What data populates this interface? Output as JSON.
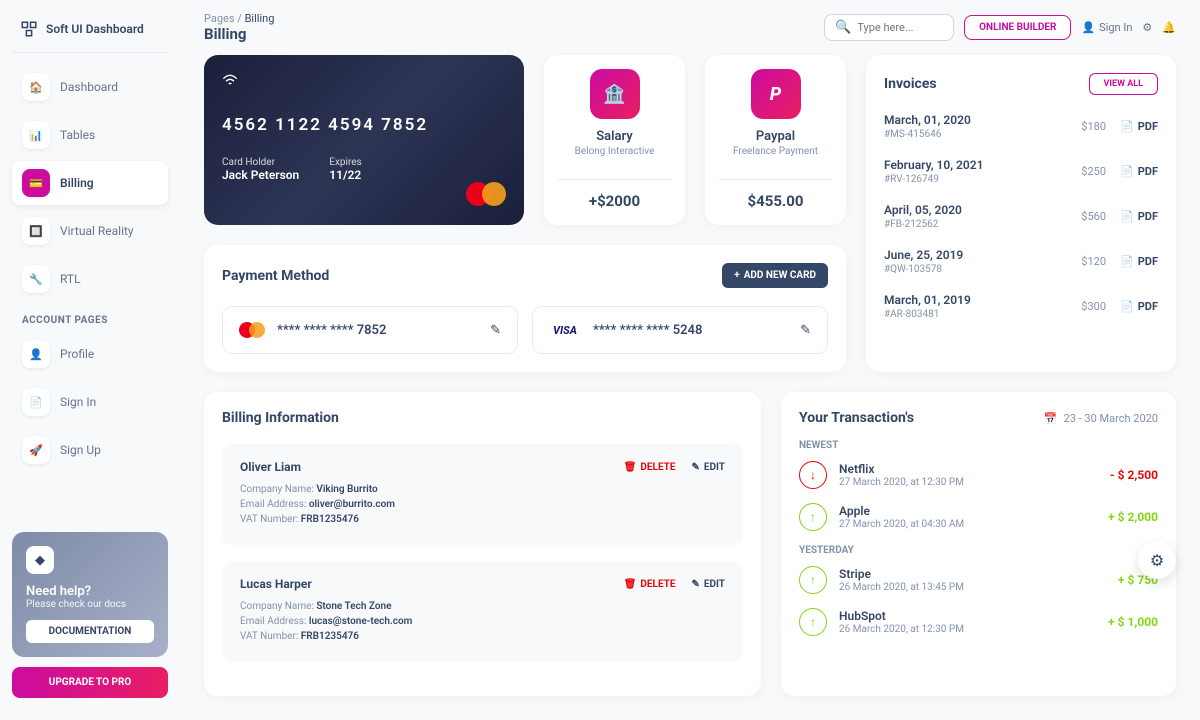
{
  "brand": "Soft UI Dashboard",
  "breadcrumb": {
    "root": "Pages",
    "current": "Billing"
  },
  "page_title": "Billing",
  "search_placeholder": "Type here...",
  "topbar": {
    "online_builder": "ONLINE BUILDER",
    "sign_in": "Sign In"
  },
  "nav": {
    "primary": [
      {
        "label": "Dashboard",
        "icon": "🏠"
      },
      {
        "label": "Tables",
        "icon": "📊"
      },
      {
        "label": "Billing",
        "icon": "💳"
      },
      {
        "label": "Virtual Reality",
        "icon": "🔲"
      },
      {
        "label": "RTL",
        "icon": "🔧"
      }
    ],
    "section": "ACCOUNT PAGES",
    "account": [
      {
        "label": "Profile",
        "icon": "👤"
      },
      {
        "label": "Sign In",
        "icon": "📄"
      },
      {
        "label": "Sign Up",
        "icon": "🚀"
      }
    ]
  },
  "help": {
    "title": "Need help?",
    "sub": "Please check our docs",
    "btn": "DOCUMENTATION"
  },
  "upgrade": "UPGRADE TO PRO",
  "credit_card": {
    "number": "4562   1122   4594   7852",
    "holder_label": "Card Holder",
    "holder": "Jack Peterson",
    "expires_label": "Expires",
    "expires": "11/22"
  },
  "stats": [
    {
      "title": "Salary",
      "sub": "Belong Interactive",
      "value": "+$2000",
      "icon": "🏦"
    },
    {
      "title": "Paypal",
      "sub": "Freelance Payment",
      "value": "$455.00",
      "icon": "P"
    }
  ],
  "invoices": {
    "title": "Invoices",
    "view_all": "VIEW ALL",
    "pdf": "PDF",
    "items": [
      {
        "date": "March, 01, 2020",
        "id": "#MS-415646",
        "amount": "$180"
      },
      {
        "date": "February, 10, 2021",
        "id": "#RV-126749",
        "amount": "$250"
      },
      {
        "date": "April, 05, 2020",
        "id": "#FB-212562",
        "amount": "$560"
      },
      {
        "date": "June, 25, 2019",
        "id": "#QW-103578",
        "amount": "$120"
      },
      {
        "date": "March, 01, 2019",
        "id": "#AR-803481",
        "amount": "$300"
      }
    ]
  },
  "payment_method": {
    "title": "Payment Method",
    "add": "ADD NEW CARD",
    "cards": [
      {
        "brand": "mastercard",
        "masked": "****   ****   ****   7852"
      },
      {
        "brand": "visa",
        "masked": "****   ****   ****   5248"
      }
    ]
  },
  "billing_info": {
    "title": "Billing Information",
    "labels": {
      "company": "Company Name:",
      "email": "Email Address:",
      "vat": "VAT Number:"
    },
    "delete": "DELETE",
    "edit": "EDIT",
    "items": [
      {
        "name": "Oliver Liam",
        "company": "Viking Burrito",
        "email": "oliver@burrito.com",
        "vat": "FRB1235476"
      },
      {
        "name": "Lucas Harper",
        "company": "Stone Tech Zone",
        "email": "lucas@stone-tech.com",
        "vat": "FRB1235476"
      }
    ]
  },
  "transactions": {
    "title": "Your Transaction's",
    "range": "23 - 30 March 2020",
    "sections": {
      "newest": "NEWEST",
      "yesterday": "YESTERDAY"
    },
    "newest": [
      {
        "name": "Netflix",
        "time": "27 March 2020, at 12:30 PM",
        "amount": "- $ 2,500",
        "dir": "down"
      },
      {
        "name": "Apple",
        "time": "27 March 2020, at 04:30 AM",
        "amount": "+ $ 2,000",
        "dir": "up"
      }
    ],
    "yesterday": [
      {
        "name": "Stripe",
        "time": "26 March 2020, at 13:45 PM",
        "amount": "+ $ 750",
        "dir": "up"
      },
      {
        "name": "HubSpot",
        "time": "26 March 2020, at 12:30 PM",
        "amount": "+ $ 1,000",
        "dir": "up"
      }
    ]
  }
}
